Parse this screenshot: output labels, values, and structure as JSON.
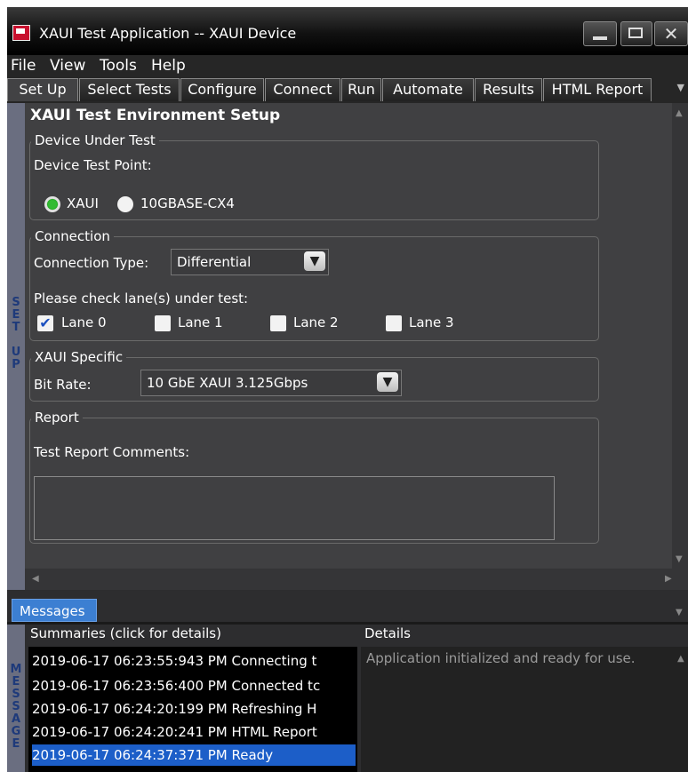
{
  "window": {
    "title": "XAUI Test Application -- XAUI Device",
    "controls": [
      "minimize",
      "maximize",
      "close"
    ]
  },
  "menu": {
    "items": [
      "File",
      "View",
      "Tools",
      "Help"
    ]
  },
  "tabs": [
    "Set Up",
    "Select Tests",
    "Configure",
    "Connect",
    "Run",
    "Automate",
    "Results",
    "HTML Report"
  ],
  "active_tab": "Set Up",
  "setup": {
    "sidebar_label": "SET UP",
    "heading": "XAUI Test Environment Setup",
    "device_under_test": {
      "legend": "Device Under Test",
      "test_point_label": "Device Test Point:",
      "options": [
        {
          "label": "XAUI",
          "selected": true
        },
        {
          "label": "10GBASE-CX4",
          "selected": false
        }
      ]
    },
    "connection": {
      "legend": "Connection",
      "type_label": "Connection Type:",
      "type_value": "Differential",
      "lanes_label": "Please check lane(s) under test:",
      "lanes": [
        {
          "label": "Lane 0",
          "checked": true
        },
        {
          "label": "Lane 1",
          "checked": false
        },
        {
          "label": "Lane 2",
          "checked": false
        },
        {
          "label": "Lane 3",
          "checked": false
        }
      ]
    },
    "xaui_specific": {
      "legend": "XAUI Specific",
      "bit_rate_label": "Bit Rate:",
      "bit_rate_value": "10 GbE XAUI 3.125Gbps"
    },
    "report": {
      "legend": "Report",
      "comments_label": "Test Report Comments:",
      "comments_value": ""
    }
  },
  "messages": {
    "tab_label": "Messages",
    "sidebar_label": "MESSAGE",
    "summaries_header": "Summaries (click for details)",
    "details_header": "Details",
    "summaries": [
      "2019-06-17 06:23:55:943 PM Connecting t",
      "2019-06-17 06:23:56:400 PM Connected tc",
      "2019-06-17 06:24:20:199 PM Refreshing H",
      "2019-06-17 06:24:20:241 PM HTML Report",
      "2019-06-17 06:24:37:371 PM Ready"
    ],
    "selected_index": 4,
    "details_text": "Application initialized and ready for use."
  },
  "colors": {
    "accent": "#1c5ec8",
    "panel": "#404042",
    "titlebar": "#000000"
  }
}
